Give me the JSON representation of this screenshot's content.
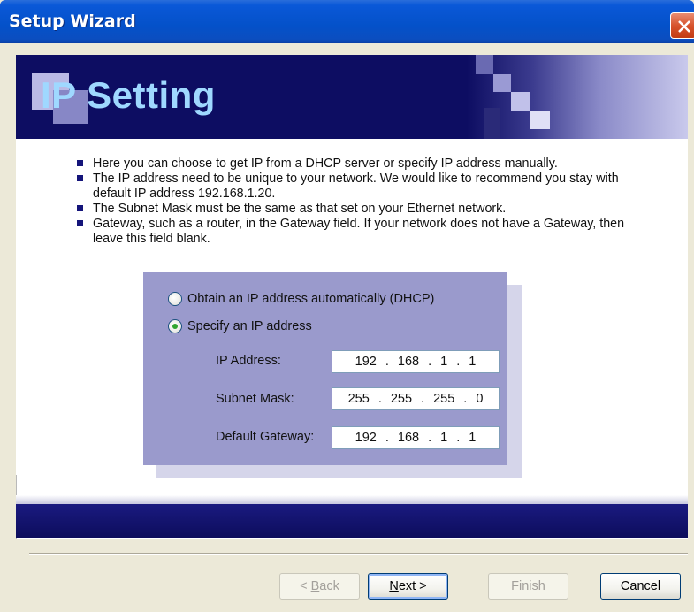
{
  "window": {
    "title": "Setup Wizard"
  },
  "banner": {
    "title": "IP Setting"
  },
  "bullets": [
    "Here you can choose to get IP from a DHCP server or specify IP address manually.",
    "The IP address need to be unique to your network. We would like to recommend you stay with default IP address 192.168.1.20.",
    "The Subnet Mask must be the same as that set on your Ethernet network.",
    "Gateway, such as a router, in the Gateway field. If your network does not have a Gateway, then leave this field blank."
  ],
  "options": {
    "dhcp_label": "Obtain an IP address automatically (DHCP)",
    "static_label": "Specify an IP address",
    "selected": "static"
  },
  "fields": {
    "ip_label": "IP Address:",
    "ip_value": [
      "192",
      "168",
      "1",
      "1"
    ],
    "mask_label": "Subnet Mask:",
    "mask_value": [
      "255",
      "255",
      "255",
      "0"
    ],
    "gateway_label": "Default Gateway:",
    "gateway_value": [
      "192",
      "168",
      "1",
      "1"
    ]
  },
  "buttons": {
    "back": {
      "mnemonic": "B",
      "rest": "ack",
      "enabled": false
    },
    "next": {
      "mnemonic": "N",
      "rest": "ext",
      "enabled": true
    },
    "finish": {
      "label": "Finish",
      "enabled": false
    },
    "cancel": {
      "label": "Cancel",
      "enabled": true
    }
  },
  "colors": {
    "titlebar": "#0451c9",
    "banner": "#0d0d62",
    "panel": "#9a9acc",
    "title_accent": "#9fd8ff"
  }
}
